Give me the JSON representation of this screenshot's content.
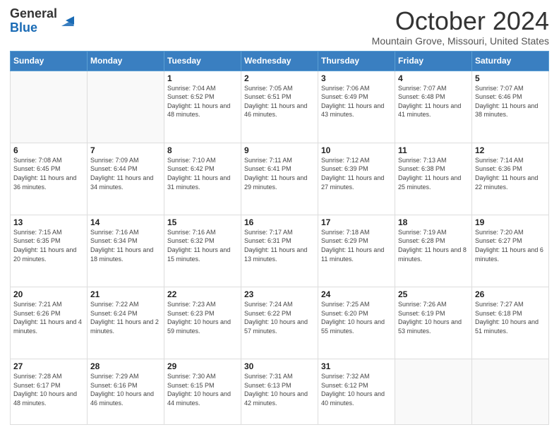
{
  "logo": {
    "line1": "General",
    "line2": "Blue"
  },
  "header": {
    "month": "October 2024",
    "location": "Mountain Grove, Missouri, United States"
  },
  "weekdays": [
    "Sunday",
    "Monday",
    "Tuesday",
    "Wednesday",
    "Thursday",
    "Friday",
    "Saturday"
  ],
  "weeks": [
    [
      {
        "day": "",
        "info": ""
      },
      {
        "day": "",
        "info": ""
      },
      {
        "day": "1",
        "info": "Sunrise: 7:04 AM\nSunset: 6:52 PM\nDaylight: 11 hours and 48 minutes."
      },
      {
        "day": "2",
        "info": "Sunrise: 7:05 AM\nSunset: 6:51 PM\nDaylight: 11 hours and 46 minutes."
      },
      {
        "day": "3",
        "info": "Sunrise: 7:06 AM\nSunset: 6:49 PM\nDaylight: 11 hours and 43 minutes."
      },
      {
        "day": "4",
        "info": "Sunrise: 7:07 AM\nSunset: 6:48 PM\nDaylight: 11 hours and 41 minutes."
      },
      {
        "day": "5",
        "info": "Sunrise: 7:07 AM\nSunset: 6:46 PM\nDaylight: 11 hours and 38 minutes."
      }
    ],
    [
      {
        "day": "6",
        "info": "Sunrise: 7:08 AM\nSunset: 6:45 PM\nDaylight: 11 hours and 36 minutes."
      },
      {
        "day": "7",
        "info": "Sunrise: 7:09 AM\nSunset: 6:44 PM\nDaylight: 11 hours and 34 minutes."
      },
      {
        "day": "8",
        "info": "Sunrise: 7:10 AM\nSunset: 6:42 PM\nDaylight: 11 hours and 31 minutes."
      },
      {
        "day": "9",
        "info": "Sunrise: 7:11 AM\nSunset: 6:41 PM\nDaylight: 11 hours and 29 minutes."
      },
      {
        "day": "10",
        "info": "Sunrise: 7:12 AM\nSunset: 6:39 PM\nDaylight: 11 hours and 27 minutes."
      },
      {
        "day": "11",
        "info": "Sunrise: 7:13 AM\nSunset: 6:38 PM\nDaylight: 11 hours and 25 minutes."
      },
      {
        "day": "12",
        "info": "Sunrise: 7:14 AM\nSunset: 6:36 PM\nDaylight: 11 hours and 22 minutes."
      }
    ],
    [
      {
        "day": "13",
        "info": "Sunrise: 7:15 AM\nSunset: 6:35 PM\nDaylight: 11 hours and 20 minutes."
      },
      {
        "day": "14",
        "info": "Sunrise: 7:16 AM\nSunset: 6:34 PM\nDaylight: 11 hours and 18 minutes."
      },
      {
        "day": "15",
        "info": "Sunrise: 7:16 AM\nSunset: 6:32 PM\nDaylight: 11 hours and 15 minutes."
      },
      {
        "day": "16",
        "info": "Sunrise: 7:17 AM\nSunset: 6:31 PM\nDaylight: 11 hours and 13 minutes."
      },
      {
        "day": "17",
        "info": "Sunrise: 7:18 AM\nSunset: 6:29 PM\nDaylight: 11 hours and 11 minutes."
      },
      {
        "day": "18",
        "info": "Sunrise: 7:19 AM\nSunset: 6:28 PM\nDaylight: 11 hours and 8 minutes."
      },
      {
        "day": "19",
        "info": "Sunrise: 7:20 AM\nSunset: 6:27 PM\nDaylight: 11 hours and 6 minutes."
      }
    ],
    [
      {
        "day": "20",
        "info": "Sunrise: 7:21 AM\nSunset: 6:26 PM\nDaylight: 11 hours and 4 minutes."
      },
      {
        "day": "21",
        "info": "Sunrise: 7:22 AM\nSunset: 6:24 PM\nDaylight: 11 hours and 2 minutes."
      },
      {
        "day": "22",
        "info": "Sunrise: 7:23 AM\nSunset: 6:23 PM\nDaylight: 10 hours and 59 minutes."
      },
      {
        "day": "23",
        "info": "Sunrise: 7:24 AM\nSunset: 6:22 PM\nDaylight: 10 hours and 57 minutes."
      },
      {
        "day": "24",
        "info": "Sunrise: 7:25 AM\nSunset: 6:20 PM\nDaylight: 10 hours and 55 minutes."
      },
      {
        "day": "25",
        "info": "Sunrise: 7:26 AM\nSunset: 6:19 PM\nDaylight: 10 hours and 53 minutes."
      },
      {
        "day": "26",
        "info": "Sunrise: 7:27 AM\nSunset: 6:18 PM\nDaylight: 10 hours and 51 minutes."
      }
    ],
    [
      {
        "day": "27",
        "info": "Sunrise: 7:28 AM\nSunset: 6:17 PM\nDaylight: 10 hours and 48 minutes."
      },
      {
        "day": "28",
        "info": "Sunrise: 7:29 AM\nSunset: 6:16 PM\nDaylight: 10 hours and 46 minutes."
      },
      {
        "day": "29",
        "info": "Sunrise: 7:30 AM\nSunset: 6:15 PM\nDaylight: 10 hours and 44 minutes."
      },
      {
        "day": "30",
        "info": "Sunrise: 7:31 AM\nSunset: 6:13 PM\nDaylight: 10 hours and 42 minutes."
      },
      {
        "day": "31",
        "info": "Sunrise: 7:32 AM\nSunset: 6:12 PM\nDaylight: 10 hours and 40 minutes."
      },
      {
        "day": "",
        "info": ""
      },
      {
        "day": "",
        "info": ""
      }
    ]
  ]
}
